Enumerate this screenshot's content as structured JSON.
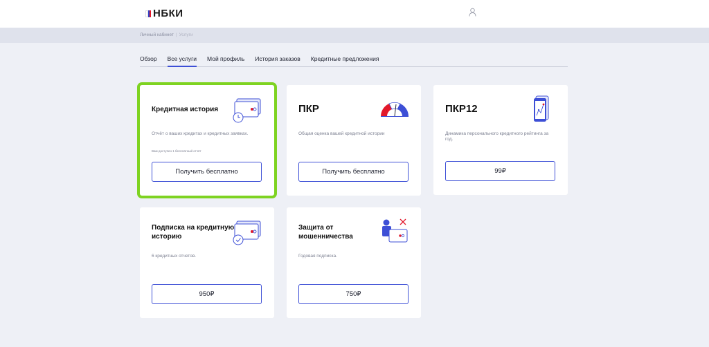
{
  "header": {
    "logo_text": "НБКИ",
    "flag_colors": [
      "#ffffff",
      "#2f43c8",
      "#e2182a"
    ]
  },
  "breadcrumb": {
    "home": "Личный кабинет",
    "separator": "|",
    "current": "Услуги"
  },
  "tabs": [
    {
      "label": "Обзор",
      "active": false
    },
    {
      "label": "Все услуги",
      "active": true
    },
    {
      "label": "Мой профиль",
      "active": false
    },
    {
      "label": "История заказов",
      "active": false
    },
    {
      "label": "Кредитные предложения",
      "active": false
    }
  ],
  "colors": {
    "accent": "#3d4fd6",
    "highlight": "#7ed321",
    "danger": "#e2182a"
  },
  "cards": [
    {
      "title": "Кредитная история",
      "description": "Отчёт о ваших кредитах и кредитных заявках.",
      "note": "Вам доступен 1 бесплатный отчёт",
      "button": "Получить бесплатно",
      "icon": "credit-report-clock-icon"
    },
    {
      "title": "ПКР",
      "description": "Общая оценка вашей кредитной истории",
      "button": "Получить бесплатно",
      "icon": "rating-gauge-icon"
    },
    {
      "title": "ПКР12",
      "description": "Динамика персонального кредитного рейтинга за год.",
      "button": "99₽",
      "icon": "phone-chart-icon"
    },
    {
      "title": "Подписка на кредитную историю",
      "description": "6 кредитных отчетов.",
      "button": "950₽",
      "icon": "credit-report-check-icon"
    },
    {
      "title": "Защита от мошенничества",
      "description": "Годовая подписка.",
      "button": "750₽",
      "icon": "fraud-protection-icon"
    }
  ]
}
